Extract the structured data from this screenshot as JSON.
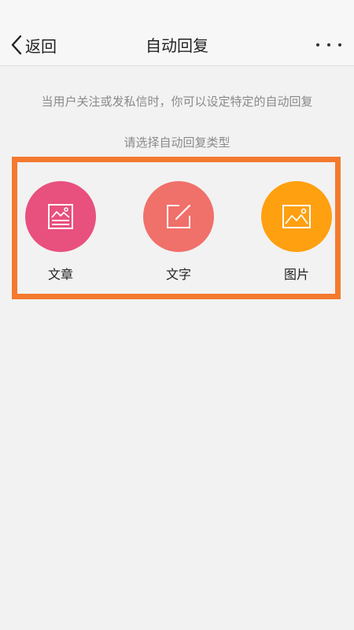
{
  "header": {
    "back_label": "返回",
    "title": "自动回复",
    "more_icon": "more-horizontal-icon"
  },
  "main": {
    "description": "当用户关注或发私信时，你可以设定特定的自动回复",
    "prompt": "请选择自动回复类型",
    "options": [
      {
        "label": "文章",
        "icon": "article-icon",
        "color": "#e8507e"
      },
      {
        "label": "文字",
        "icon": "edit-icon",
        "color": "#f0706a"
      },
      {
        "label": "图片",
        "icon": "image-icon",
        "color": "#ffa010"
      }
    ],
    "highlight_color": "#f47a2f"
  }
}
